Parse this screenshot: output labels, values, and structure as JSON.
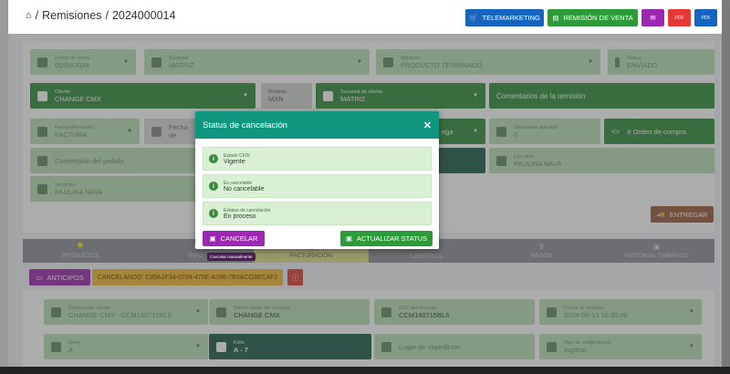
{
  "breadcrumb": {
    "home_icon": "home-icon",
    "section": "Remisiones",
    "separator": "/",
    "record": "2024000014"
  },
  "toolbar": {
    "telemarketing": "TELEMARKETING",
    "remision_venta": "REMISIÓN DE VENTA",
    "pdf1": "PDF",
    "pdf2": "PDF",
    "colors": {
      "blue": "#1565c0",
      "green": "#2e9b3a",
      "purple": "#9c27b0",
      "red": "#e53935"
    }
  },
  "form": {
    "fecha_venta": {
      "label": "Fecha de venta",
      "value": "05/06/2024"
    },
    "sucursal": {
      "label": "Sucursal",
      "value": "MATRIZ"
    },
    "almacen": {
      "label": "Almacén",
      "value": "PRODUCTO TERMINADO"
    },
    "status": {
      "label": "Status",
      "value": "ENVIADO"
    },
    "cliente": {
      "label": "Cliente",
      "value": "CHANGE CMX"
    },
    "moneda": {
      "label": "Moneda",
      "value": "MXN"
    },
    "sucursal_cliente": {
      "label": "Sucursal de cliente",
      "value": "MATRIZ"
    },
    "comentarios_remision": "Comentarios de la remisión",
    "factura_remision": {
      "label": "Factura/Remisión",
      "value": "FACTURA"
    },
    "fecha_partial": "Fecha de",
    "entrega_partial": "ega",
    "descuento": {
      "label": "Descuento aplicado",
      "value": "0"
    },
    "orden_compra": "# Orden de compra",
    "comentario_pedido": "Comentario del pedido",
    "ejecutivo": {
      "label": "Ejecutivo",
      "value": "PAULINA NAVA"
    },
    "vendedor": {
      "label": "Vendedor",
      "value": "PAULINA NAVA"
    },
    "entregar": "ENTREGAR"
  },
  "tabs": [
    {
      "label": "PRODUCTOS",
      "icon": "bulb-icon"
    },
    {
      "label": "INFO",
      "icon": "send-icon"
    },
    {
      "label": "FACTURACIÓN",
      "icon": "invoice-icon"
    },
    {
      "label": "LOGÍSTICA",
      "icon": "truck-icon"
    },
    {
      "label": "PAGOS",
      "icon": "dollar-icon"
    },
    {
      "label": "HISTORIAL TIMBRADO",
      "icon": "history-icon"
    }
  ],
  "billing": {
    "anticipos": "ANTICIPOS",
    "cancelando": "CANCELANDO: C89A2F34-0704-470E-A296-7B3ACO3ECAF2",
    "cliente": {
      "label": "Seleccionar cliente",
      "value": "CHANGE CMX - CCM140715BL6"
    },
    "razon_social": {
      "label": "Razón social del receptor",
      "value": "CHANGE CMX"
    },
    "rfc": {
      "label": "RFC del receptor",
      "value": "CCM140715BL6"
    },
    "fecha_emision": {
      "label": "Fecha de emisión",
      "value": "2024-06-13 16:30:46"
    },
    "serie": {
      "label": "Serie",
      "value": "A"
    },
    "folio": {
      "label": "Folio",
      "value": "A - 7"
    },
    "lugar_expedicion": "Lugar de expedición",
    "tipo_comprobante": {
      "label": "Tipo de comprobante",
      "value": "Ingreso"
    }
  },
  "modal": {
    "title": "Status de cancelación",
    "close": "✕",
    "rows": [
      {
        "label": "Estado CFDI",
        "value": "Vigente"
      },
      {
        "label": "Es cancelable",
        "value": "No cancelable"
      },
      {
        "label": "Estatus de cancelación",
        "value": "En proceso"
      }
    ],
    "cancel_button": "CANCELAR",
    "update_button": "ACTUALIZAR STATUS",
    "tooltip": "Cancelar manualmente"
  }
}
